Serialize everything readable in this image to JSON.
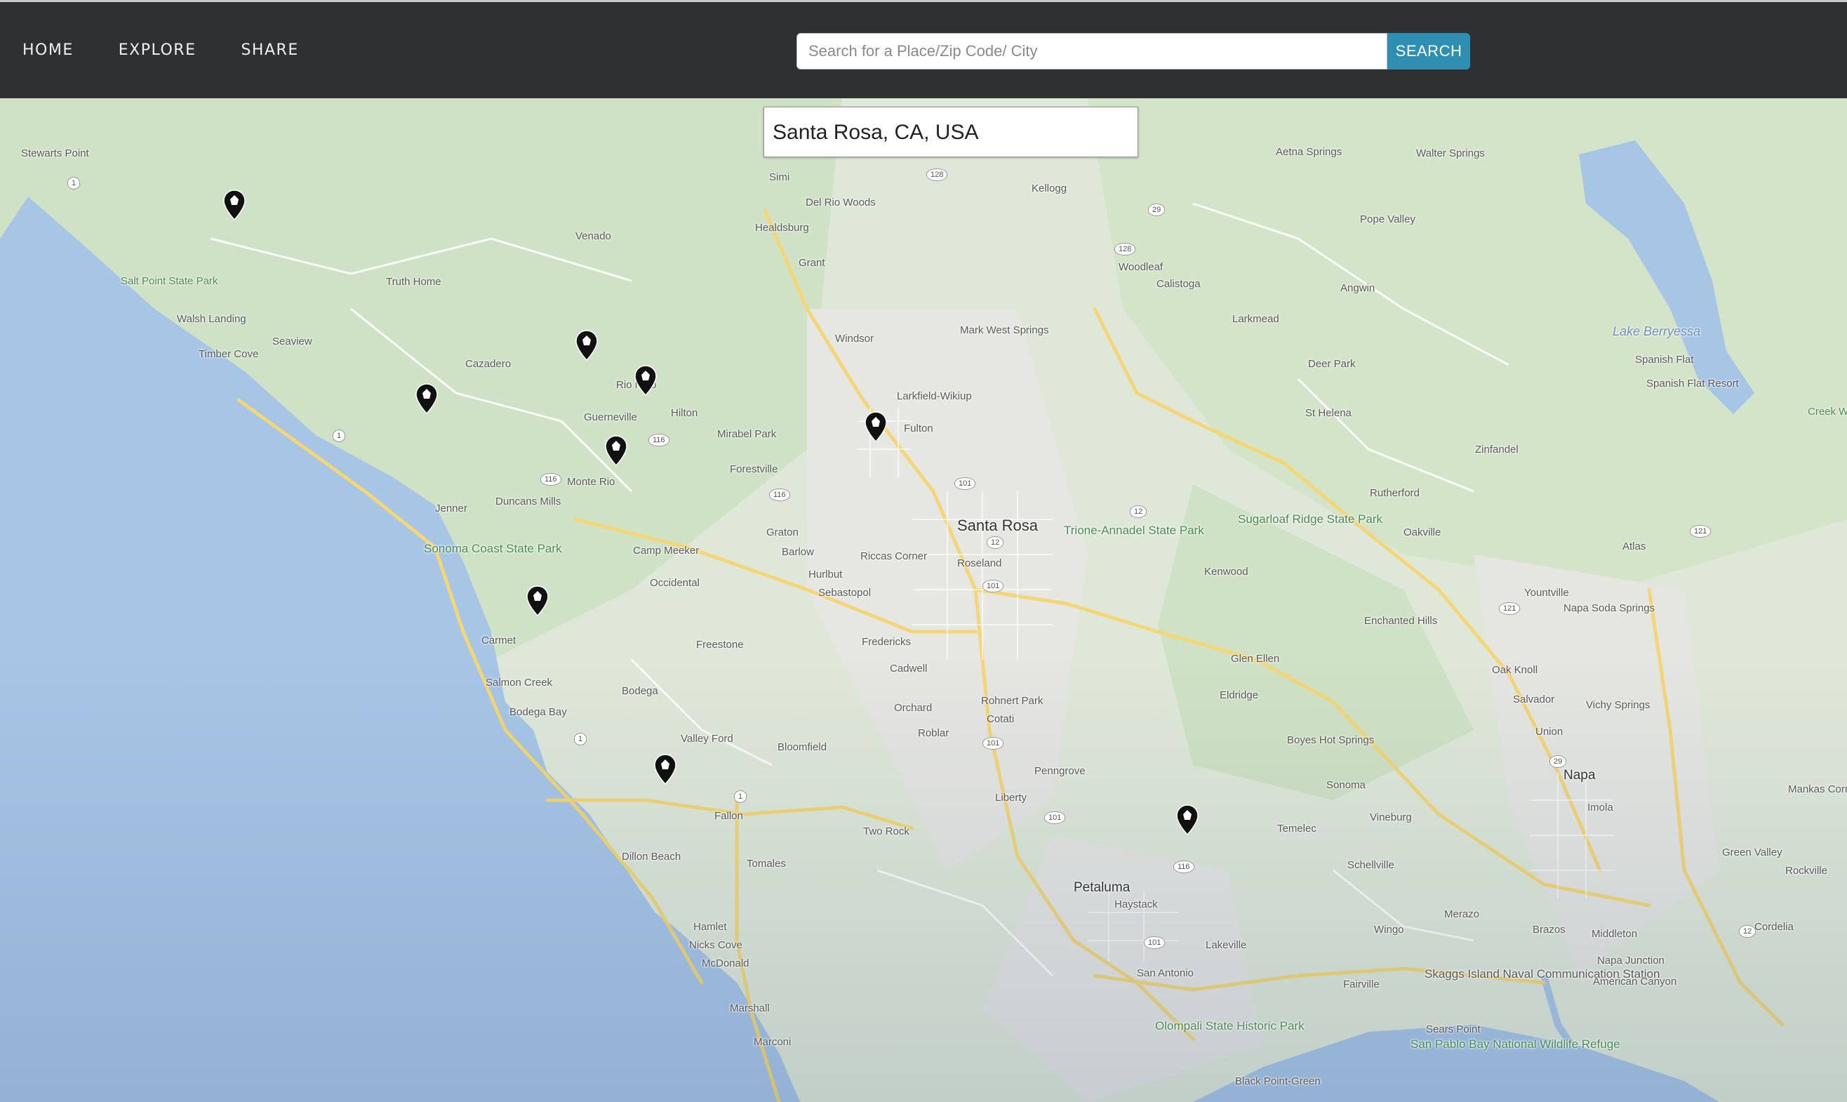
{
  "nav": {
    "items": [
      "HOME",
      "EXPLORE",
      "SHARE"
    ]
  },
  "search": {
    "placeholder": "Search for a Place/Zip Code/ City",
    "button_label": "SEARCH"
  },
  "map": {
    "current_location": "Santa Rosa, CA, USA",
    "place_labels": [
      "Stewarts Point",
      "Salt Point State Park",
      "Walsh Landing",
      "Timber Cove",
      "Seaview",
      "Venado",
      "Truth Home",
      "Cazadero",
      "Rio Nido",
      "Guerneville",
      "Hilton",
      "Monte Rio",
      "Mirabel Park",
      "Forestville",
      "Duncans Mills",
      "Jenner",
      "Sonoma Coast State Park",
      "Camp Meeker",
      "Occidental",
      "Graton",
      "Barlow",
      "Hurlbut",
      "Sebastopol",
      "Riccas Corner",
      "Roseland",
      "Santa Rosa",
      "Trione-Annadel State Park",
      "Fulton",
      "Larkfield-Wikiup",
      "Windsor",
      "Mark West Springs",
      "Healdsburg",
      "Del Rio Woods",
      "Simi",
      "Grant",
      "Kellogg",
      "Aetna Springs",
      "Walter Springs",
      "Pope Valley",
      "Woodleaf",
      "Calistoga",
      "Angwin",
      "Larkmead",
      "Deer Park",
      "St Helena",
      "Lake Berryessa",
      "Spanish Flat",
      "Spanish Flat Resort",
      "Zinfandel",
      "Rutherford",
      "Oakville",
      "Sugarloaf Ridge State Park",
      "Kenwood",
      "Atlas",
      "Yountville",
      "Napa Soda Springs",
      "Enchanted Hills",
      "Glen Ellen",
      "Oak Knoll",
      "Eldridge",
      "Salvador",
      "Vichy Springs",
      "Union",
      "Napa",
      "Imola",
      "Boyes Hot Springs",
      "Sonoma",
      "Vineburg",
      "Temelec",
      "Schellville",
      "Green Valley",
      "Rockville",
      "Carmet",
      "Freestone",
      "Fredericks",
      "Cadwell",
      "Salmon Creek",
      "Bodega",
      "Bodega Bay",
      "Valley Ford",
      "Bloomfield",
      "Orchard",
      "Rohnert Park",
      "Cotati",
      "Roblar",
      "Penngrove",
      "Liberty",
      "Two Rock",
      "Fallon",
      "Tomales",
      "Dillon Beach",
      "Hamlet",
      "Nicks Cove",
      "McDonald",
      "Marshall",
      "Marconi",
      "Petaluma",
      "Haystack",
      "Lakeville",
      "San Antonio",
      "Olompali State Historic Park",
      "Wingo",
      "Skaggs Island Naval Communication Station",
      "Fairville",
      "Sears Point",
      "San Pablo Bay National Wildlife Refuge",
      "Merazo",
      "Brazos",
      "Middleton",
      "Napa Junction",
      "American Canyon",
      "Cordelia",
      "Black Point-Green",
      "Bodega Bay (water)",
      "Mankas Corner",
      "Creek Wildlife"
    ],
    "markers": [
      {
        "name": "marker-timber-cove"
      },
      {
        "name": "marker-guerneville"
      },
      {
        "name": "marker-forestville"
      },
      {
        "name": "marker-jenner"
      },
      {
        "name": "marker-camp-meeker"
      },
      {
        "name": "marker-riccas-corner"
      },
      {
        "name": "marker-bodega-bay"
      },
      {
        "name": "marker-dillon-beach"
      },
      {
        "name": "marker-lakeville"
      }
    ]
  }
}
